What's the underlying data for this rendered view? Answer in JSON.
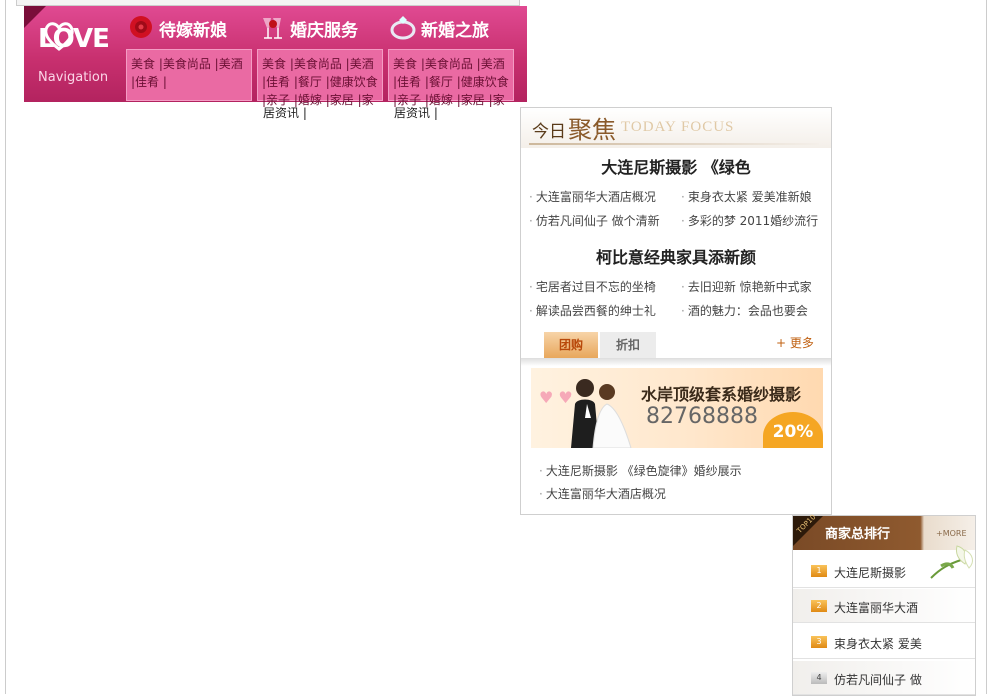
{
  "nav_banner": {
    "logo_text": "LOVE",
    "logo_subtext": "Navigation",
    "columns": [
      {
        "title": "待嫁新娘",
        "lines": [
          "美食 |美食尚品 |美酒",
          "|佳肴 |"
        ],
        "overflow": ""
      },
      {
        "title": "婚庆服务",
        "lines": [
          "美食 |美食尚品 |美酒",
          "|佳肴 |餐厅 |健康饮食",
          "|亲子 |婚嫁 |家居 |家"
        ],
        "overflow": "居资讯 |"
      },
      {
        "title": "新婚之旅",
        "lines": [
          "美食 |美食尚品 |美酒",
          "|佳肴 |餐厅 |健康饮食",
          "|亲子 |婚嫁 |家居 |家"
        ],
        "overflow": "居资讯 |"
      }
    ]
  },
  "focus": {
    "title_cn_small": "今日",
    "title_cn_big": "聚焦",
    "title_en": "TODAY FOCUS",
    "headline1": "大连尼斯摄影 《绿色",
    "news1": [
      "大连富丽华大酒店概况",
      "束身衣太紧 爱美准新娘",
      "仿若凡间仙子 做个清新",
      "多彩的梦 2011婚纱流行"
    ],
    "headline2": "柯比意经典家具添新颜",
    "news2": [
      "宅居者过目不忘的坐椅",
      "去旧迎新 惊艳新中式家",
      "解读品尝西餐的绅士礼",
      "酒的魅力：会品也要会"
    ],
    "tab_active": "团购",
    "tab_inactive": "折扣",
    "more": "+ 更多",
    "ad_title": "水岸顶级套系婚纱摄影",
    "ad_phone": "82768888",
    "ad_badge": "20%",
    "bottom_links": [
      "大连尼斯摄影 《绿色旋律》婚纱展示",
      "大连富丽华大酒店概况"
    ]
  },
  "ranking": {
    "corner": "TOP10",
    "title": "商家总排行",
    "more": "+MORE",
    "items": [
      {
        "num": "1",
        "name": "大连尼斯摄影"
      },
      {
        "num": "2",
        "name": "大连富丽华大酒"
      },
      {
        "num": "3",
        "name": "束身衣太紧 爱美"
      },
      {
        "num": "4",
        "name": "仿若凡间仙子 做"
      }
    ]
  },
  "colors": {
    "banner_pink": "#c8306f",
    "accent_orange": "#e8a75c",
    "rank_brown": "#7a4a26"
  }
}
